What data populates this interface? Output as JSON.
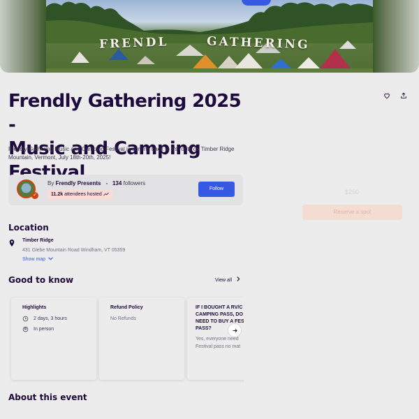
{
  "hero": {
    "sign_left": "FRENDL",
    "sign_right": "GATHERING"
  },
  "event": {
    "title_line1": "Frendly Gathering 2025 -",
    "title_line2": "Music and Camping Festival",
    "description": "Frendly Gathering Music and Camping Festival is coming back to it's roots on Timber Ridge Mountain, Vermont, July 18th-20th, 2025!"
  },
  "actions": {
    "like_icon": "heart-icon",
    "share_icon": "share-icon"
  },
  "organizer": {
    "by_prefix": "By",
    "name": "Frendly Presents",
    "followers_count": "134",
    "followers_label": "followers",
    "attendees_count": "11.2k",
    "attendees_label": "attendees hosted",
    "follow_label": "Follow"
  },
  "ticket_panel": {
    "price": "$250",
    "checkout_label": "Reserve a spot"
  },
  "location": {
    "heading": "Location",
    "venue": "Timber Ridge",
    "address": "431 Glebe Mountain Road Windham, VT 05359",
    "show_map": "Show map"
  },
  "good_to_know": {
    "heading": "Good to know",
    "view_all": "View all",
    "highlights": {
      "title": "Highlights",
      "duration": "2 days, 3 hours",
      "format": "In person"
    },
    "refund": {
      "title": "Refund Policy",
      "value": "No Refunds"
    },
    "faq": {
      "question_lines": [
        "IF I BOUGHT A RV/C",
        "CAMPING PASS, DO",
        "NEED TO BUY A FEST",
        "PASS?"
      ],
      "answer_lines": [
        "Yes, everyone need",
        "Festival pass no mat"
      ]
    }
  },
  "about": {
    "heading": "About this event"
  },
  "colors": {
    "accent": "#3659e3",
    "brand_orange": "#d1410c",
    "title": "#1e0a3c"
  }
}
